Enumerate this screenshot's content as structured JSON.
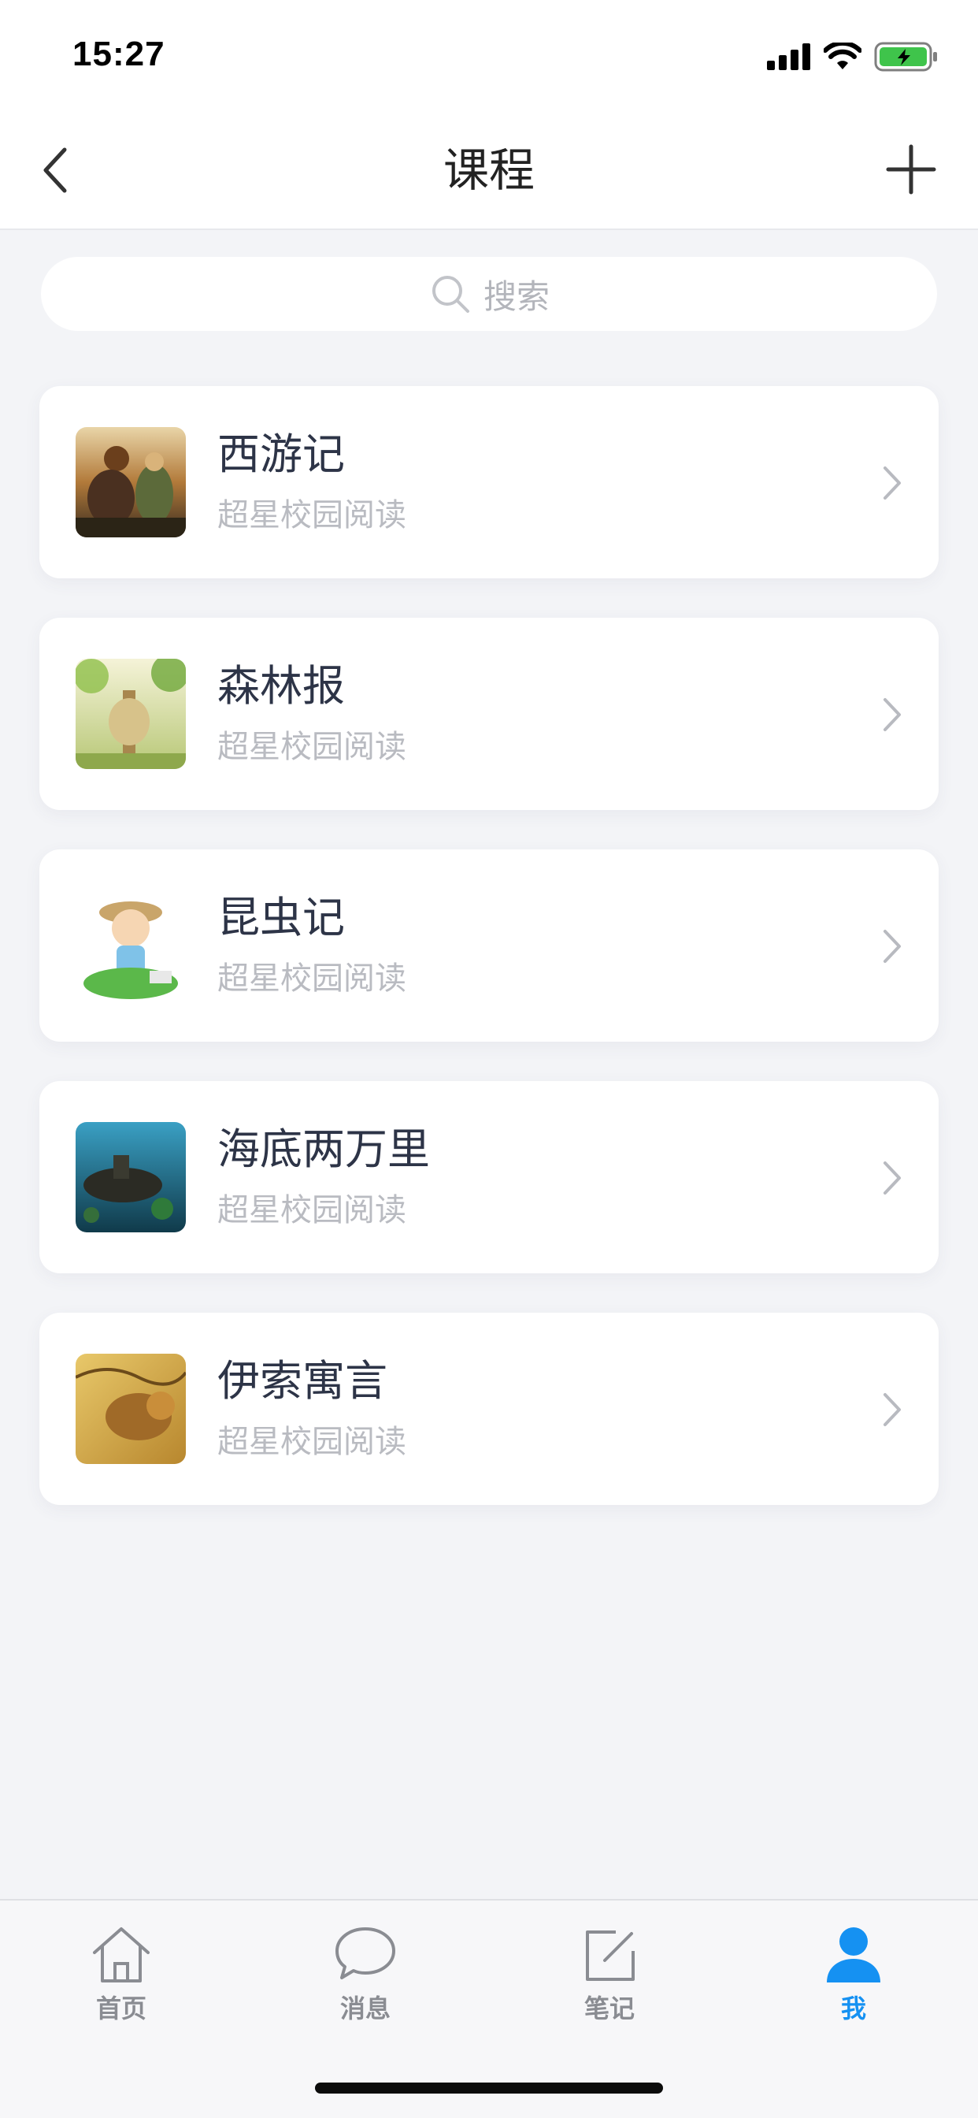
{
  "status_bar": {
    "time": "15:27"
  },
  "nav": {
    "title": "课程"
  },
  "search": {
    "placeholder": "搜索"
  },
  "courses": [
    {
      "title": "西游记",
      "subtitle": "超星校园阅读"
    },
    {
      "title": "森林报",
      "subtitle": "超星校园阅读"
    },
    {
      "title": "昆虫记",
      "subtitle": "超星校园阅读"
    },
    {
      "title": "海底两万里",
      "subtitle": "超星校园阅读"
    },
    {
      "title": "伊索寓言",
      "subtitle": "超星校园阅读"
    }
  ],
  "tabbar": {
    "items": [
      {
        "label": "首页",
        "icon": "home-icon"
      },
      {
        "label": "消息",
        "icon": "message-icon"
      },
      {
        "label": "笔记",
        "icon": "note-icon"
      },
      {
        "label": "我",
        "icon": "profile-icon",
        "active": true
      }
    ]
  },
  "colors": {
    "accent": "#1591f2",
    "background": "#f3f4f7"
  }
}
